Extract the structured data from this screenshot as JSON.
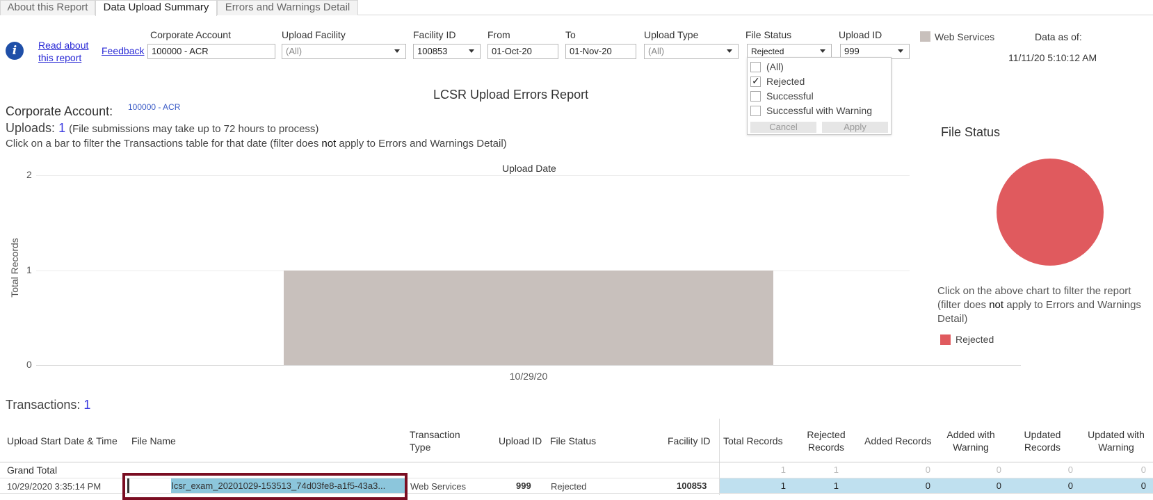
{
  "tabs": [
    {
      "label": "About this Report"
    },
    {
      "label": "Data Upload Summary"
    },
    {
      "label": "Errors and Warnings Detail"
    }
  ],
  "links": {
    "read_about": "Read about this report",
    "feedback": "Feedback"
  },
  "filters": {
    "corporate_account": {
      "label": "Corporate Account",
      "value": "100000 - ACR"
    },
    "upload_facility": {
      "label": "Upload Facility",
      "value": "(All)"
    },
    "facility_id": {
      "label": "Facility ID",
      "value": "100853"
    },
    "from": {
      "label": "From",
      "value": "01-Oct-20"
    },
    "to": {
      "label": "To",
      "value": "01-Nov-20"
    },
    "upload_type": {
      "label": "Upload Type",
      "value": "(All)"
    },
    "file_status": {
      "label": "File Status",
      "value": "Rejected"
    },
    "upload_id": {
      "label": "Upload ID",
      "value": "999"
    }
  },
  "file_status_dropdown": {
    "options": [
      {
        "label": "(All)",
        "checked": false
      },
      {
        "label": "Rejected",
        "checked": true
      },
      {
        "label": "Successful",
        "checked": false
      },
      {
        "label": "Successful with Warning",
        "checked": false
      }
    ],
    "cancel": "Cancel",
    "apply": "Apply"
  },
  "legend_top": {
    "label": "Web Services",
    "color": "#c8c0bc"
  },
  "data_as_of": {
    "label": "Data as of:",
    "value": "11/11/20 5:10:12 AM"
  },
  "report_title": "LCSR Upload Errors Report",
  "summary": {
    "corporate_label": "Corporate Account:",
    "corporate_value": "100000 - ACR",
    "uploads_label": "Uploads:",
    "uploads_value": "1",
    "uploads_note": "(File submissions may take up to 72 hours to process)",
    "click_pre": "Click on a bar to filter the Transactions table for that date (filter does ",
    "click_bold": "not",
    "click_post": " apply to Errors and Warnings Detail)"
  },
  "chart_data": {
    "type": "bar",
    "title": "Upload Date",
    "ylabel": "Total Records",
    "categories": [
      "10/29/20"
    ],
    "values": [
      1
    ],
    "ylim": [
      0,
      2
    ],
    "yticks": [
      "0",
      "1",
      "2"
    ],
    "color": "#c8c0bc"
  },
  "file_status_panel": {
    "title": "File Status",
    "pie_color": "#e05a5e",
    "note_pre": "Click on the above chart to filter the report (filter does ",
    "note_bold": "not",
    "note_post": " apply to Errors and Warnings Detail)",
    "legend": "Rejected"
  },
  "transactions": {
    "label": "Transactions:",
    "count": "1",
    "columns": [
      "Upload Start Date & Time",
      "File Name",
      "Transaction Type",
      "Upload ID",
      "File Status",
      "Facility ID",
      "Total Records",
      "Rejected Records",
      "Added Records",
      "Added with Warning",
      "Updated Records",
      "Updated with Warning"
    ],
    "grand_total": {
      "label": "Grand Total",
      "total": "1",
      "rejected": "1",
      "added": "0",
      "added_warn": "0",
      "updated": "0",
      "updated_warn": "0"
    },
    "row": {
      "datetime": "10/29/2020 3:35:14 PM",
      "file_name": "lcsr_exam_20201029-153513_74d03fe8-a1f5-43a3...",
      "type": "Web Services",
      "upload_id": "999",
      "status": "Rejected",
      "facility_id": "100853",
      "total": "1",
      "rejected": "1",
      "added": "0",
      "added_warn": "0",
      "updated": "0",
      "updated_warn": "0"
    }
  }
}
